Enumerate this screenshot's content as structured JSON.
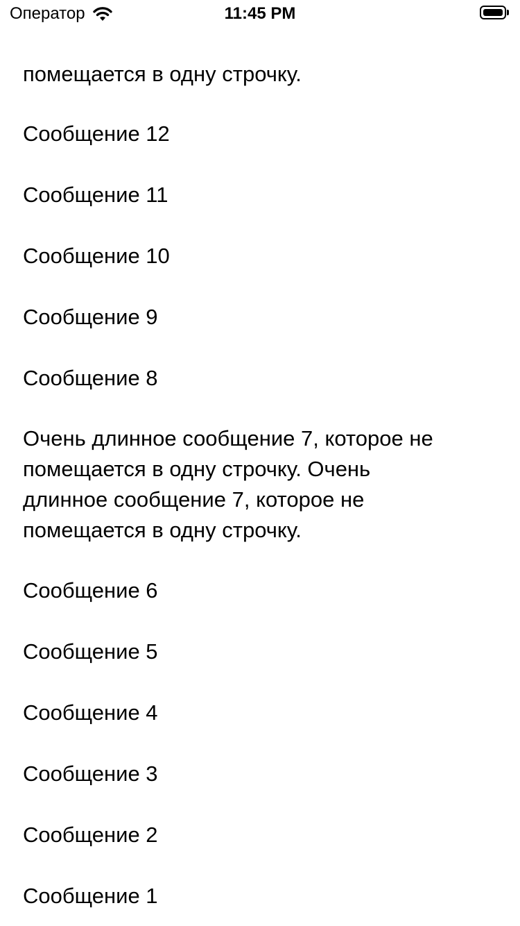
{
  "status_bar": {
    "carrier": "Оператор",
    "time": "11:45 PM",
    "wifi_icon": "wifi-icon",
    "battery_icon": "battery-full-icon"
  },
  "messages": [
    "помещается в одну строчку.",
    "Сообщение 12",
    "Сообщение 11",
    "Сообщение 10",
    "Сообщение 9",
    "Сообщение 8",
    "Очень длинное сообщение 7, которое не\nпомещается в одну строчку. Очень\nдлинное сообщение 7, которое не\nпомещается в одну строчку.",
    "Сообщение 6",
    "Сообщение 5",
    "Сообщение 4",
    "Сообщение 3",
    "Сообщение 2",
    "Сообщение 1"
  ]
}
